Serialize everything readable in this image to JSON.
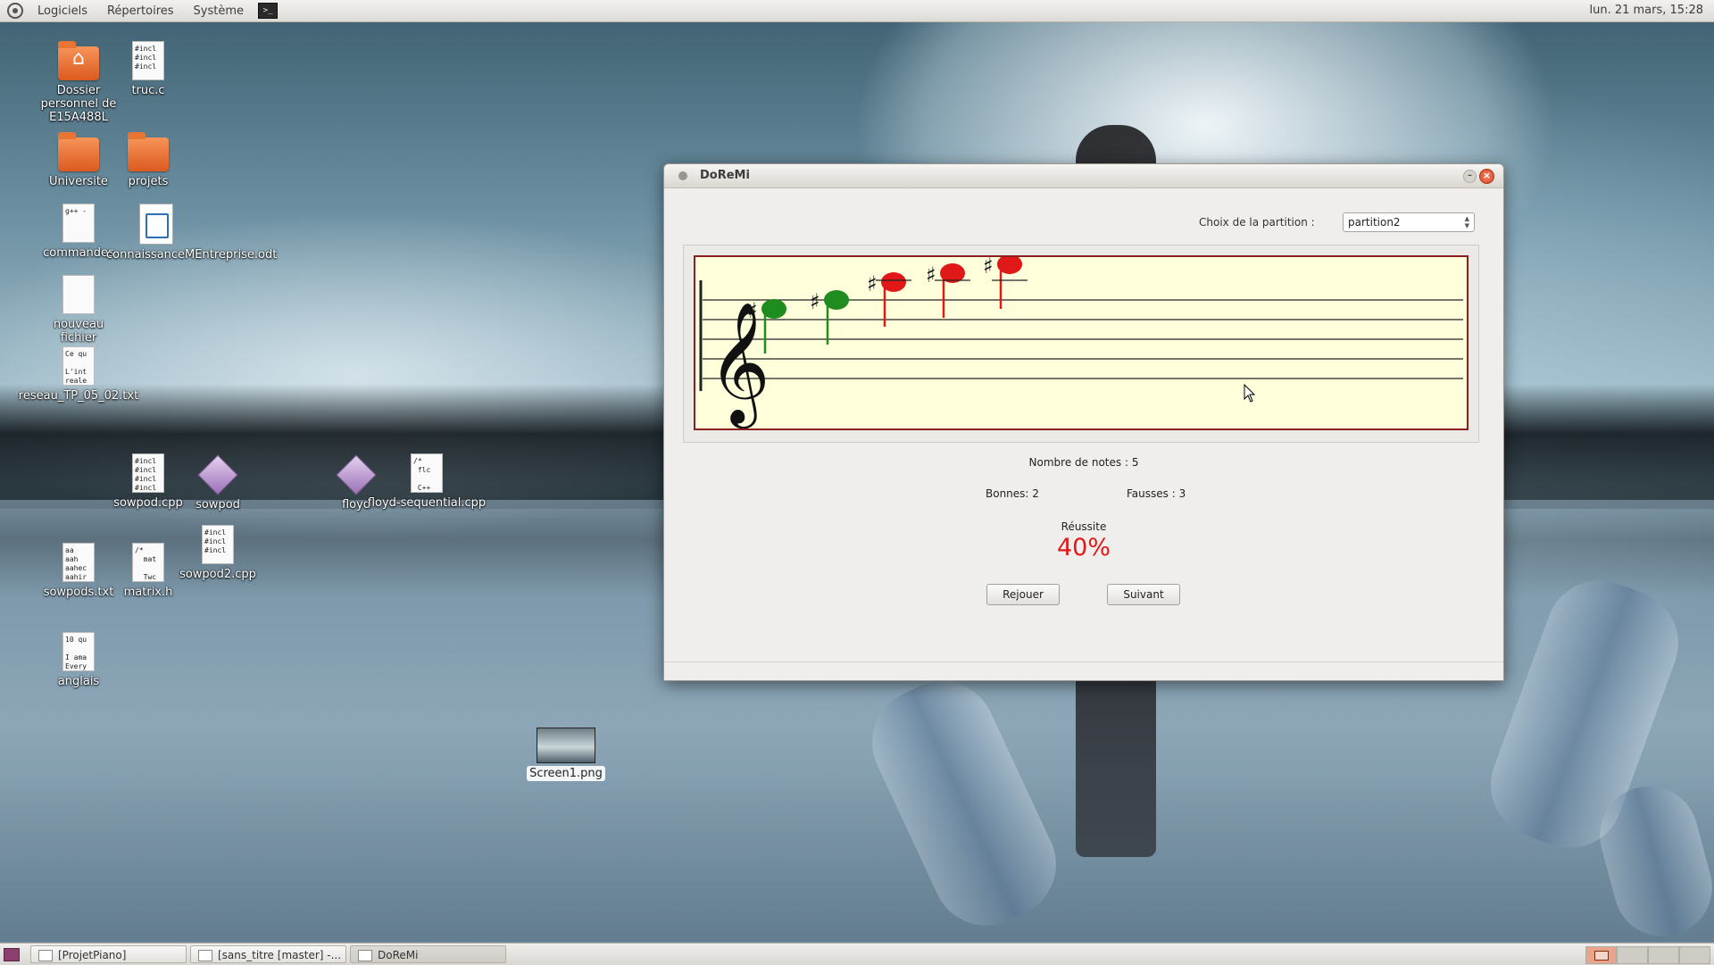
{
  "top_panel": {
    "menus": [
      "Logiciels",
      "Répertoires",
      "Système"
    ],
    "clock": "lun. 21 mars, 15:28"
  },
  "desktop_icons": [
    {
      "label": "Dossier personnel de E15A488L",
      "type": "home-folder"
    },
    {
      "label": "truc.c",
      "type": "source",
      "preview": "#incl\n#incl\n#incl"
    },
    {
      "label": "Universite",
      "type": "folder"
    },
    {
      "label": "projets",
      "type": "folder"
    },
    {
      "label": "commandes",
      "type": "script",
      "preview": "g++ -"
    },
    {
      "label": "connaissanceMEntreprise.odt",
      "type": "odt"
    },
    {
      "label": "nouveau fichier",
      "type": "text",
      "preview": ""
    },
    {
      "label": "reseau_TP_05_02.txt",
      "type": "text",
      "preview": "Ce qu\n\nL'int\nreale"
    },
    {
      "label": "sowpod.cpp",
      "type": "source",
      "preview": "#incl\n#incl\n#incl\n#incl"
    },
    {
      "label": "sowpod",
      "type": "executable"
    },
    {
      "label": "floyd",
      "type": "executable"
    },
    {
      "label": "floyd-sequential.cpp",
      "type": "source",
      "preview": "/*\n flc\n\n C++"
    },
    {
      "label": "sowpods.txt",
      "type": "text",
      "preview": "aa\naah\naahec\naahir"
    },
    {
      "label": "matrix.h",
      "type": "source",
      "preview": "/*\n  mat\n\n  Twc"
    },
    {
      "label": "sowpod2.cpp",
      "type": "source",
      "preview": "#incl\n#incl\n#incl"
    },
    {
      "label": "anglais",
      "type": "text",
      "preview": "10 qu\n\nI ama\nEvery"
    },
    {
      "label": "Screen1.png",
      "type": "image"
    }
  ],
  "window": {
    "title": "DoReMi",
    "choice_label": "Choix de la partition :",
    "partition_selected": "partition2",
    "notes_count_text": "Nombre de notes : 5",
    "good_text": "Bonnes: 2",
    "bad_text": "Fausses : 3",
    "success_label": "Réussite",
    "success_value": "40%",
    "replay_button": "Rejouer",
    "next_button": "Suivant",
    "colors": {
      "correct": "#1e8c1e",
      "wrong": "#e01818",
      "staff_bg": "#ffffdc",
      "staff_border": "#8b1e1e"
    },
    "notes": [
      {
        "accidental": "sharp",
        "result": "correct"
      },
      {
        "accidental": "sharp",
        "result": "correct"
      },
      {
        "accidental": "sharp",
        "result": "wrong"
      },
      {
        "accidental": "sharp",
        "result": "wrong"
      },
      {
        "accidental": "sharp",
        "result": "wrong"
      }
    ]
  },
  "taskbar": {
    "tasks": [
      "[ProjetPiano]",
      "[sans_titre [master] -...",
      "DoReMi"
    ],
    "active_task": "DoReMi"
  }
}
